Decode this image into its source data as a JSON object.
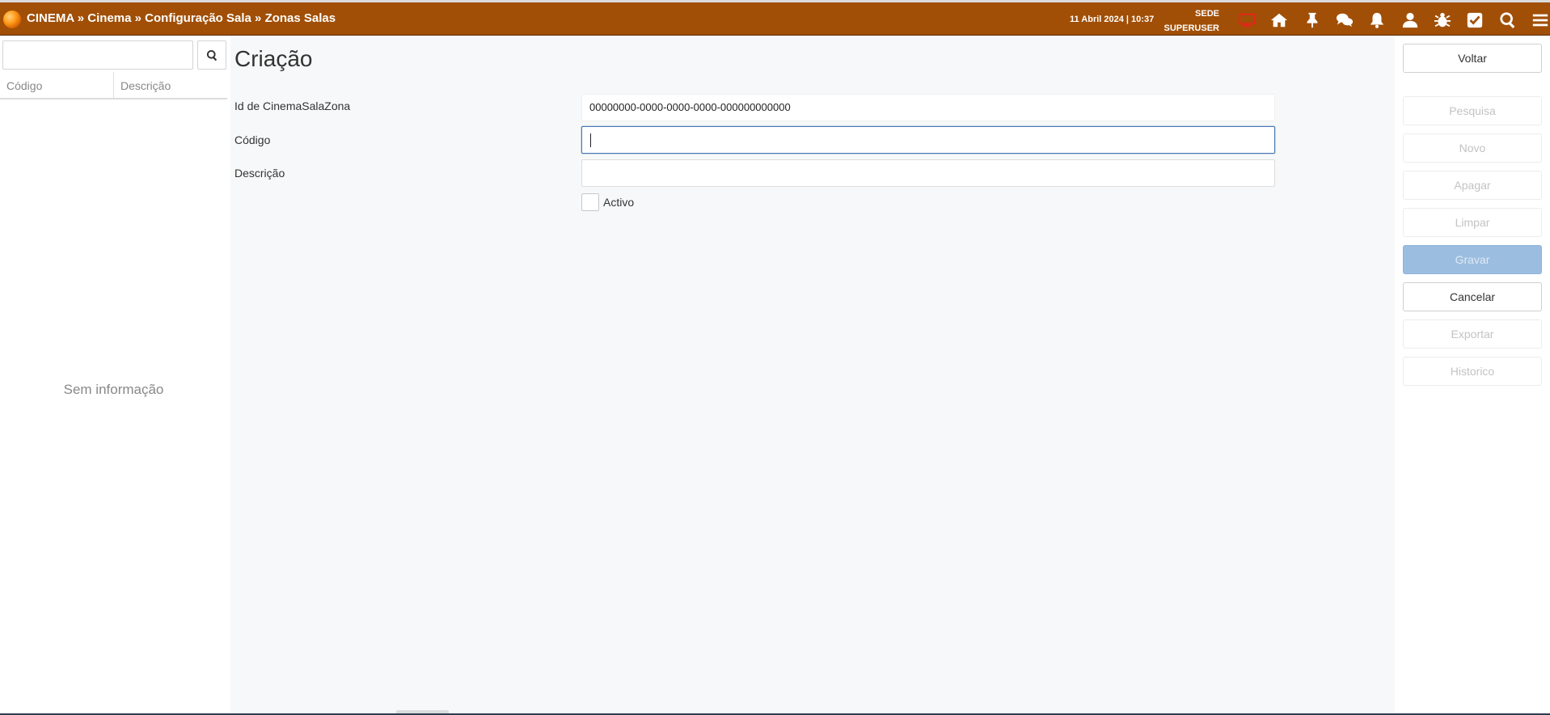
{
  "header": {
    "breadcrumb": [
      "CINEMA",
      "Cinema",
      "Configuração Sala",
      "Zonas Salas"
    ],
    "separator": " » ",
    "datetime": "11 Abril 2024 | 10:37",
    "site": "SEDE",
    "user": "SUPERUSER",
    "icons": [
      "monitor-icon",
      "home-icon",
      "pin-icon",
      "chat-icon",
      "bell-icon",
      "user-icon",
      "bug-icon",
      "checkbox-icon",
      "search-icon",
      "menu-icon"
    ],
    "accent_color": "#a14f06",
    "alert_icon_color": "#e8231a"
  },
  "sidebar": {
    "search_value": "",
    "columns": [
      "Código",
      "Descrição"
    ],
    "empty_message": "Sem informação"
  },
  "main": {
    "title": "Criação",
    "fields": {
      "id_label": "Id de CinemaSalaZona",
      "id_value": "00000000-0000-0000-0000-000000000000",
      "code_label": "Código",
      "code_value": "",
      "desc_label": "Descrição",
      "desc_value": "",
      "active_label": "Activo",
      "active_checked": false
    }
  },
  "actions": {
    "voltar": "Voltar",
    "pesquisa": "Pesquisa",
    "novo": "Novo",
    "apagar": "Apagar",
    "limpar": "Limpar",
    "gravar": "Gravar",
    "cancelar": "Cancelar",
    "exportar": "Exportar",
    "historico": "Historico"
  }
}
